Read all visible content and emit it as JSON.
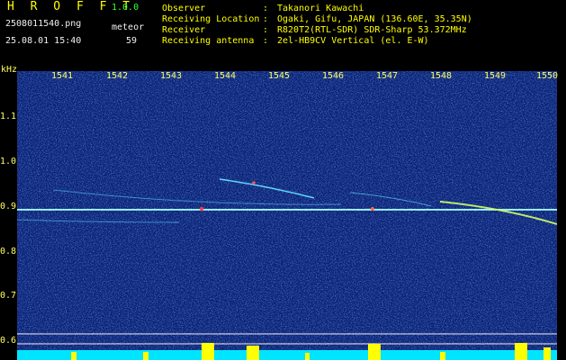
{
  "header": {
    "app_name": "H R O F F T",
    "app_version": "1.0.0",
    "file_name": "2508011540.png",
    "meteor_label": "meteor",
    "timestamp": "25.08.01 15:40",
    "meteor_count": "59",
    "info": [
      {
        "key": "Observer",
        "value": "Takanori Kawachi"
      },
      {
        "key": "Receiving Location",
        "value": "Ogaki, Gifu, JAPAN (136.60E, 35.35N)"
      },
      {
        "key": "Receiver",
        "value": "R820T2(RTL-SDR) SDR-Sharp 53.372MHz"
      },
      {
        "key": "Receiving antenna",
        "value": "2el-HB9CV Vertical (el. E-W)"
      }
    ],
    "separator": ":"
  },
  "plot": {
    "unit_label": "kHz",
    "x_ticks": [
      "1541",
      "1542",
      "1543",
      "1544",
      "1545",
      "1546",
      "1547",
      "1548",
      "1549",
      "1550"
    ],
    "y_ticks": [
      "1.1",
      "1.0",
      "0.9",
      "0.8",
      "0.7",
      "0.6"
    ],
    "colors": {
      "background": "#0b2a8a",
      "carrier": "#a8ffff",
      "echo": "#66e0ff",
      "hot": "#ff4040",
      "activity_bar": "#ffff00",
      "baseline": "#00e5ff"
    }
  }
}
